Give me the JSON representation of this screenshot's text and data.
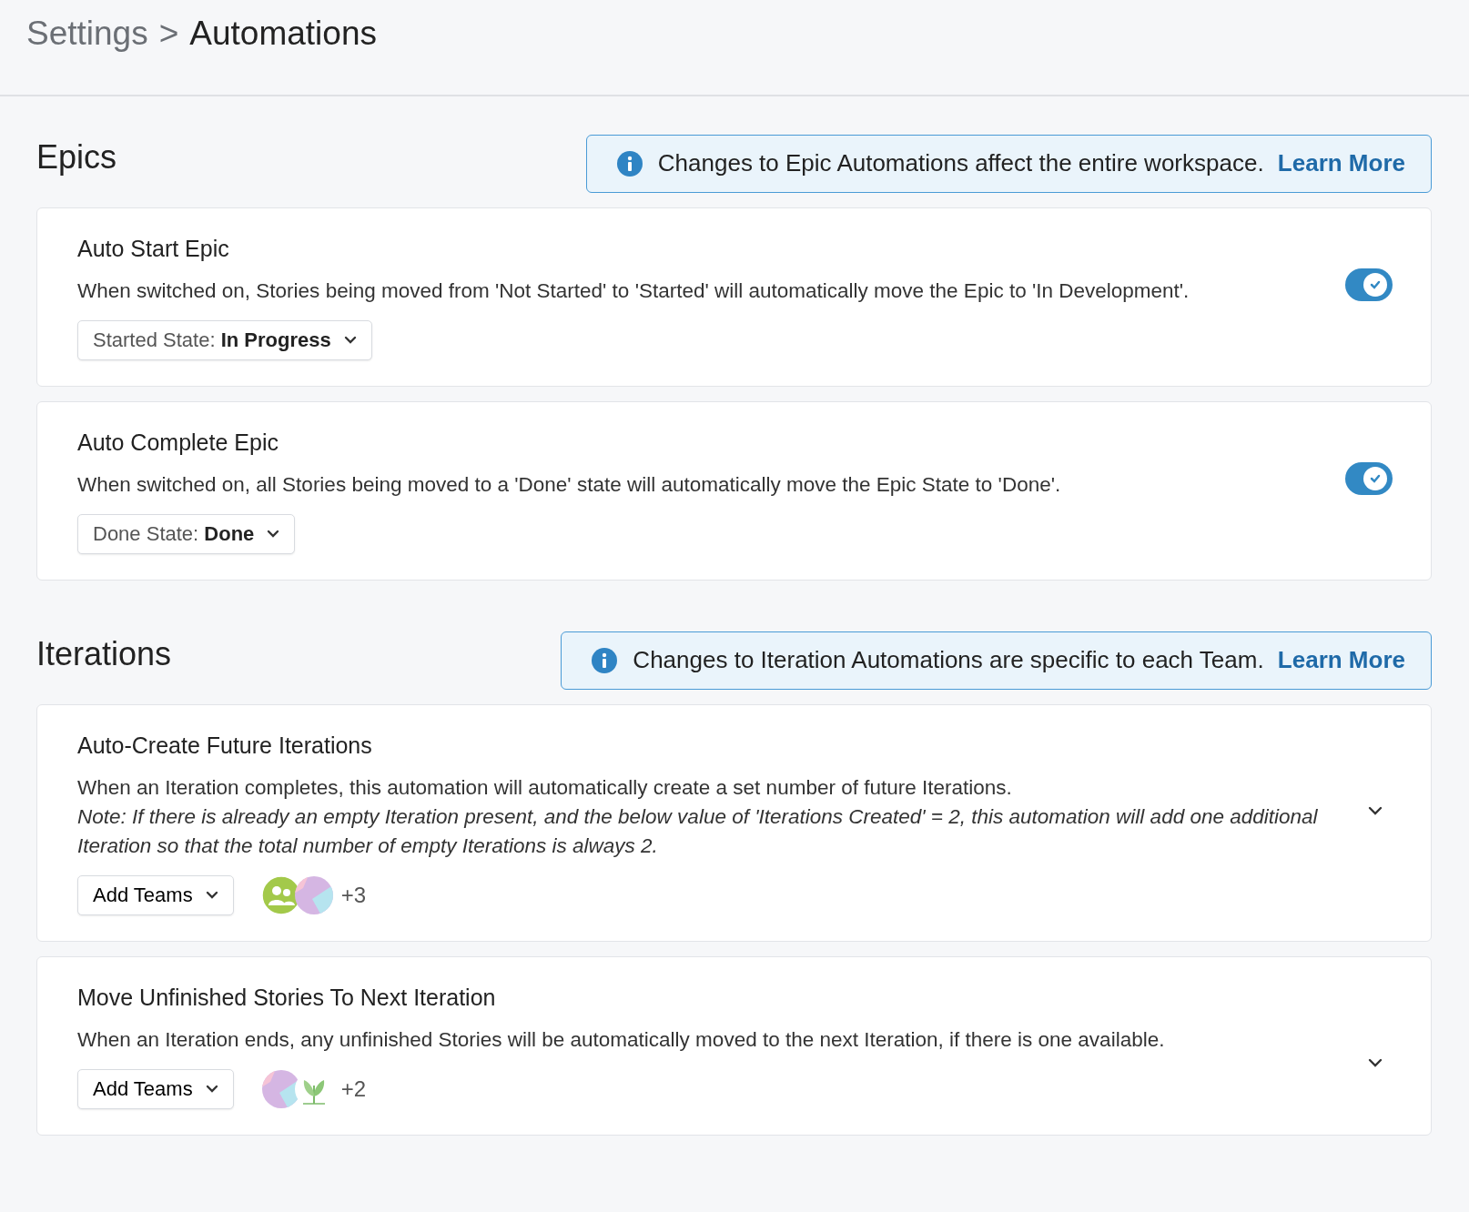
{
  "breadcrumb": {
    "parent": "Settings",
    "separator": ">",
    "current": "Automations"
  },
  "sections": [
    {
      "heading": "Epics",
      "notice": {
        "text": "Changes to Epic Automations affect the entire workspace.",
        "link": "Learn More"
      },
      "cards": [
        {
          "kind": "toggle",
          "title": "Auto Start Epic",
          "description": "When switched on, Stories being moved from 'Not Started' to 'Started' will automatically move the Epic to 'In Development'.",
          "on": true,
          "dropdown": {
            "label": "Started State:",
            "value": "In Progress"
          }
        },
        {
          "kind": "toggle",
          "title": "Auto Complete Epic",
          "description": "When switched on, all Stories being moved to a 'Done' state will automatically move the Epic State to 'Done'.",
          "on": true,
          "dropdown": {
            "label": "Done State:",
            "value": "Done"
          }
        }
      ]
    },
    {
      "heading": "Iterations",
      "notice": {
        "text": "Changes to Iteration Automations are specific to each Team.",
        "link": "Learn More"
      },
      "cards": [
        {
          "kind": "expand",
          "title": "Auto-Create Future Iterations",
          "description": "When an Iteration completes, this automation will automatically create a set number of future Iterations.",
          "note": "Note: If there is already an empty Iteration present, and the below value of 'Iterations Created' = 2, this automation will add one additional Iteration so that the total number of empty Iterations is always 2.",
          "expanded": false,
          "button": "Add Teams",
          "teams": [
            {
              "kind": "group"
            },
            {
              "kind": "pattern"
            }
          ],
          "more": "+3"
        },
        {
          "kind": "expand",
          "title": "Move Unfinished Stories To Next Iteration",
          "description": "When an Iteration ends, any unfinished Stories will be automatically moved to the next Iteration, if there is one available.",
          "expanded": false,
          "button": "Add Teams",
          "teams": [
            {
              "kind": "pattern"
            },
            {
              "kind": "plant"
            }
          ],
          "more": "+2"
        }
      ]
    }
  ]
}
